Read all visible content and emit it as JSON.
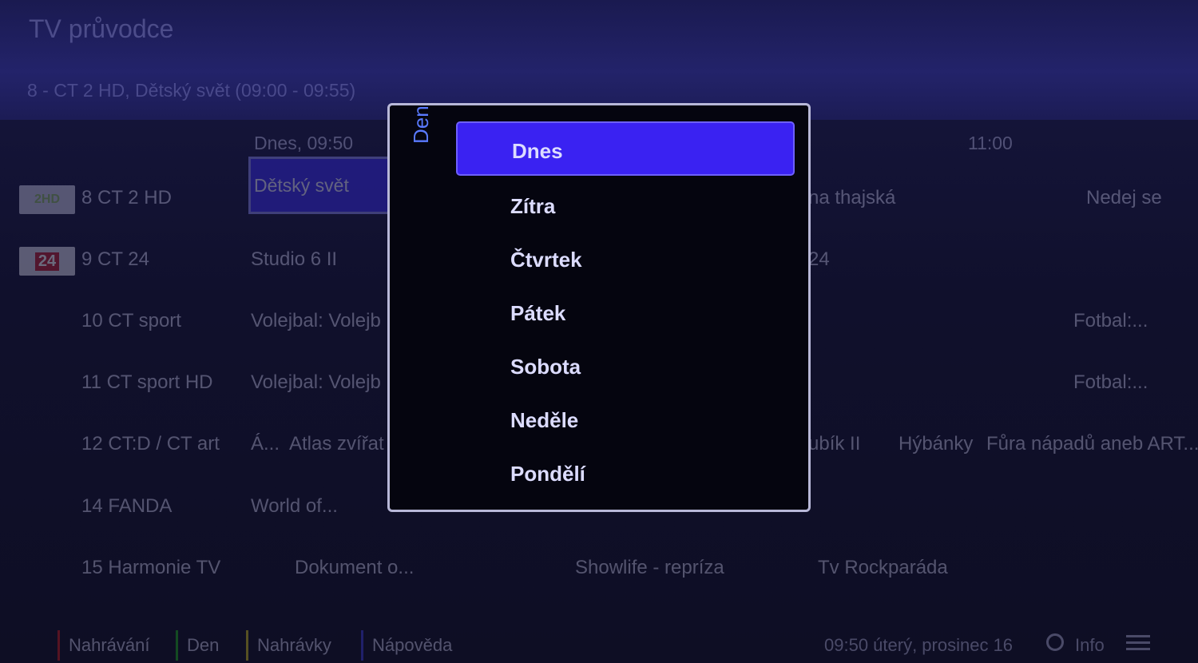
{
  "header": {
    "title": "TV průvodce",
    "current_program": "8 - CT 2 HD, Dětský svět (09:00 - 09:55)"
  },
  "timeline": {
    "left_label": "Dnes, 09:50",
    "right_label": "11:00"
  },
  "channels": [
    {
      "logo": "2HD",
      "name": "8 CT 2 HD",
      "programs": [
        "Dětský svět",
        "na thajská",
        "Nedej se"
      ]
    },
    {
      "logo": "24",
      "name": "9 CT 24",
      "programs": [
        "Studio 6 II",
        "24"
      ]
    },
    {
      "name": "10 CT sport",
      "programs": [
        "Volejbal: Volejb",
        "Fotbal:..."
      ]
    },
    {
      "name": "11 CT sport HD",
      "programs": [
        "Volejbal: Volejb",
        "Fotbal:..."
      ]
    },
    {
      "name": "12 CT:D / CT art",
      "programs": [
        "Á...",
        "Atlas zvířat",
        "ubík II",
        "Hýbánky",
        "Fůra nápadů aneb ART..."
      ]
    },
    {
      "name": "14 FANDA",
      "programs": [
        "World of..."
      ]
    },
    {
      "name": "15 Harmonie TV",
      "programs": [
        "Dokument o...",
        "Showlife - repríza",
        "Tv Rockparáda"
      ]
    }
  ],
  "footer": {
    "buttons": [
      "Nahrávání",
      "Den",
      "Nahrávky",
      "Nápověda"
    ],
    "clock": "09:50 úterý, prosinec 16",
    "info_label": "Info"
  },
  "day_dialog": {
    "title": "Den",
    "items": [
      "Dnes",
      "Zítra",
      "Čtvrtek",
      "Pátek",
      "Sobota",
      "Neděle",
      "Pondělí"
    ],
    "selected_index": 0
  },
  "colors": {
    "selection": "#3a22f2",
    "accent_text": "#5a7aff",
    "red_key": "#d02020",
    "green_key": "#20b020",
    "yellow_key": "#d0c020",
    "blue_key": "#4040e0"
  }
}
